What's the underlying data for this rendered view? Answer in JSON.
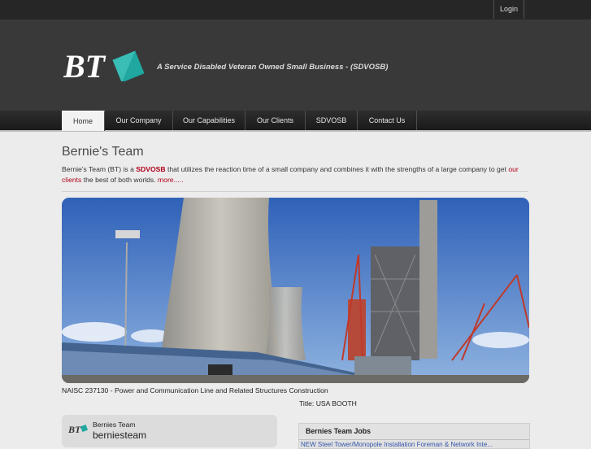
{
  "topbar": {
    "login_label": "Login"
  },
  "header": {
    "logo_text": "BT",
    "tagline": "A Service Disabled Veteran Owned Small Business - (SDVOSB)"
  },
  "nav": {
    "items": [
      {
        "label": "Home"
      },
      {
        "label": "Our Company"
      },
      {
        "label": "Our Capabilities"
      },
      {
        "label": "Our Clients"
      },
      {
        "label": "SDVOSB"
      },
      {
        "label": "Contact Us"
      }
    ]
  },
  "main": {
    "title": "Bernie's Team",
    "intro_prefix": "Bernie's Team (BT) is a ",
    "intro_sdvosb": "SDVOSB",
    "intro_middle": " that utilizes the reaction time of a small company and combines it with the strengths of a large company to get ",
    "intro_clients_link": "our clients",
    "intro_suffix": " the best of both worlds. ",
    "intro_more_link": "more.....",
    "photo_caption": "NAISC 237130 - Power and Communication Line and Related Structures Construction",
    "photo_subcaption": "Title: USA BOOTH"
  },
  "social": {
    "name": "Bernies Team",
    "handle": "berniesteam"
  },
  "jobs": {
    "title": "Bernies Team Jobs",
    "first_item": "NEW Steel Tower/Monopole Installation Foreman & Network Inte..."
  },
  "colors": {
    "accent": "#b0001a",
    "logo_teal": "#1fa7a0",
    "header_bg": "#393939"
  }
}
